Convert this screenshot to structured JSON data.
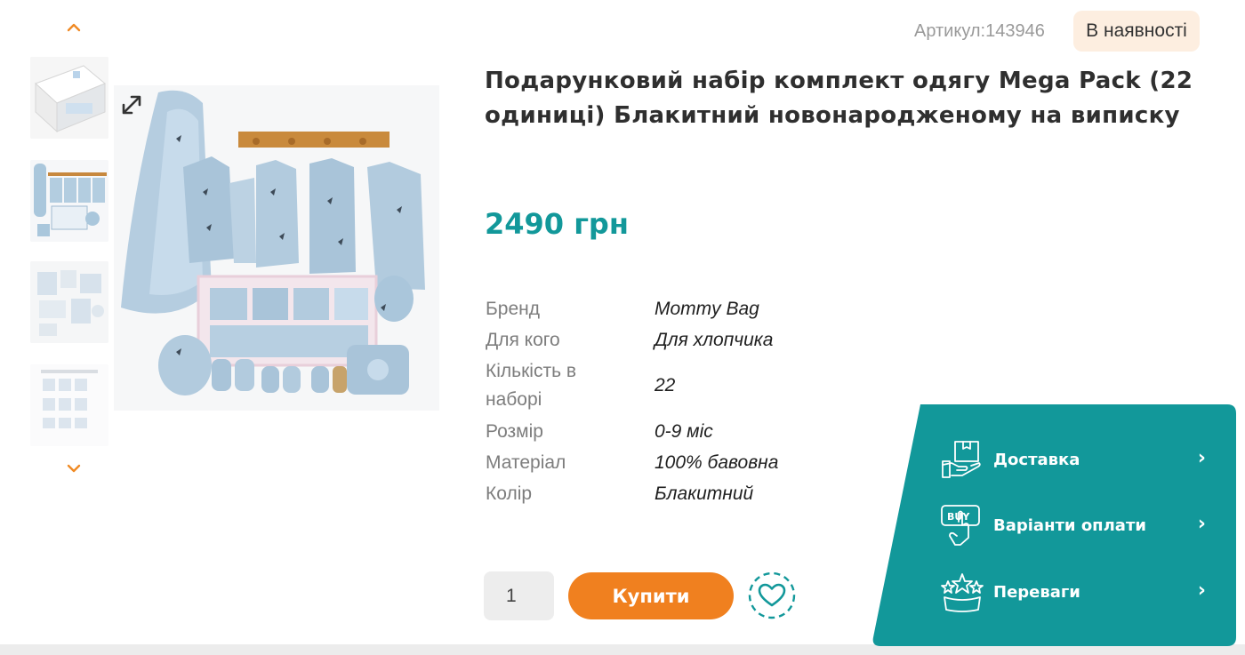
{
  "product": {
    "sku_label": "Артикул:143946",
    "availability": "В наявності",
    "title": "Подарунковий набір комплект одягу Mega Pack (22 одиниці) Блакитний новонародженому на виписку",
    "price": "2490 грн"
  },
  "specs": [
    {
      "key": "Бренд",
      "value": "Mommy Bag"
    },
    {
      "key": "Для кого",
      "value": "Для хлопчика"
    },
    {
      "key": "Кількість в наборі",
      "value": "22"
    },
    {
      "key": "Розмір",
      "value": "0-9 міс"
    },
    {
      "key": "Матеріал",
      "value": "100% бавовна"
    },
    {
      "key": "Колір",
      "value": "Блакитний"
    }
  ],
  "purchase": {
    "quantity": "1",
    "buy_label": "Купити"
  },
  "info_panel": {
    "items": [
      {
        "label": "Доставка",
        "icon": "delivery-box-icon"
      },
      {
        "label": "Варіанти оплати",
        "icon": "buy-hand-icon"
      },
      {
        "label": "Переваги",
        "icon": "advantages-stars-icon"
      }
    ],
    "arrow": "›"
  },
  "colors": {
    "accent_orange": "#f0801f",
    "teal": "#12989a",
    "badge_bg": "#fdeee0"
  }
}
